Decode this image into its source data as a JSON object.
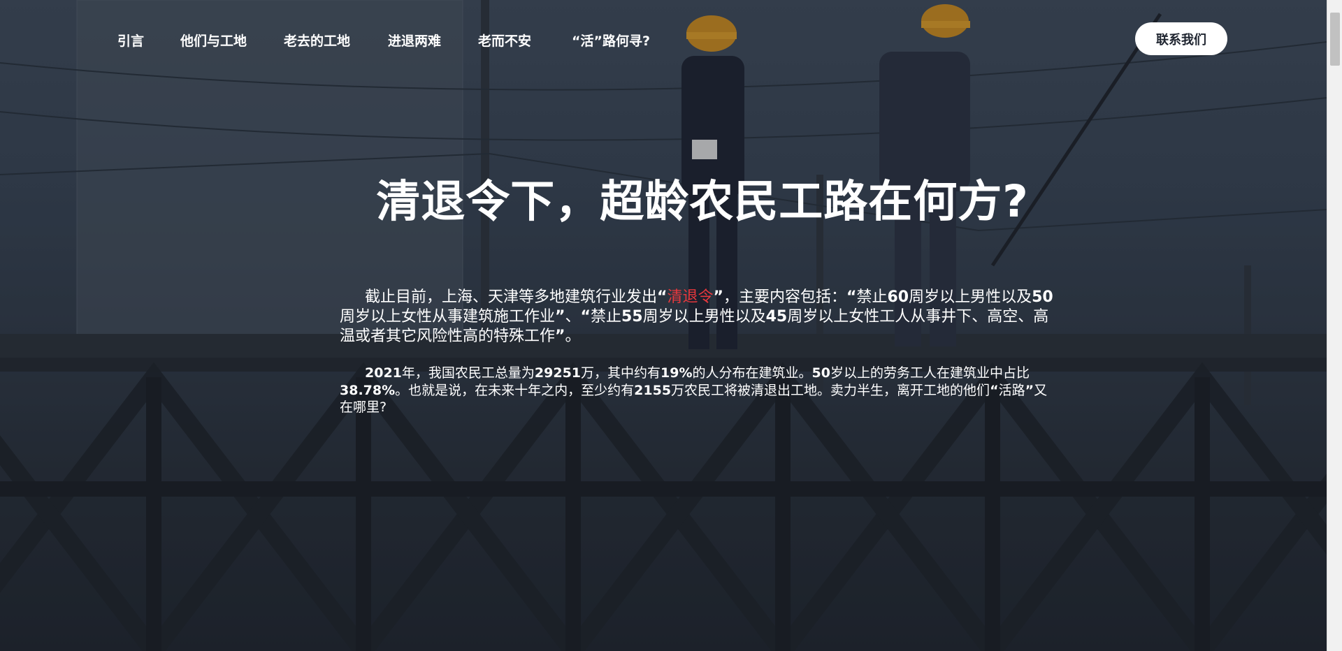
{
  "nav": {
    "items": [
      {
        "label": "引言"
      },
      {
        "label": "他们与工地"
      },
      {
        "label": "老去的工地"
      },
      {
        "label": "进退两难"
      },
      {
        "label": "老而不安"
      },
      {
        "label": "“活”路何寻?"
      }
    ],
    "contact_label": "联系我们"
  },
  "hero": {
    "title": "清退令下，超龄农民工路在何方?"
  },
  "intro": {
    "p1": {
      "s1": "截止目前，上海、天津等多地建筑行业发出",
      "q1": "“",
      "highlight": "清退令",
      "q2": "”",
      "s2": "，主要内容包括：",
      "q3": "“",
      "s3": "禁止",
      "n1": "60",
      "s4": "周岁以上男性以及",
      "n2": "50",
      "s5": "周岁以上女性从事建筑施工作业",
      "q4": "”",
      "s6": "、",
      "q5": "“",
      "s7": "禁止",
      "n3": "55",
      "s8": "周岁以上男性以及",
      "n4": "45",
      "s9": "周岁以上女性工人从事井下、高空、高温或者其它风险性高的特殊工作",
      "q6": "”",
      "s10": "。"
    },
    "p2": {
      "n1": "2021",
      "s1": "年，我国农民工总量为",
      "n2": "29251",
      "s2": "万，其中约有",
      "n3": "19%",
      "s3": "的人分布在建筑业。",
      "n4": "50",
      "s4": "岁以上的劳务工人在建筑业中占比",
      "n5": "38.78%",
      "s5": "。也就是说，在未来十年之内，至少约有",
      "n6": "2155",
      "s6": "万农民工将被清退出工地。卖力半生，离开工地的他们",
      "q1": "“",
      "s7": "活路",
      "q2": "”",
      "s8": "又在哪里?"
    }
  },
  "colors": {
    "accent_red": "#e8383d",
    "button_bg": "#ffffff",
    "text": "#ffffff"
  }
}
